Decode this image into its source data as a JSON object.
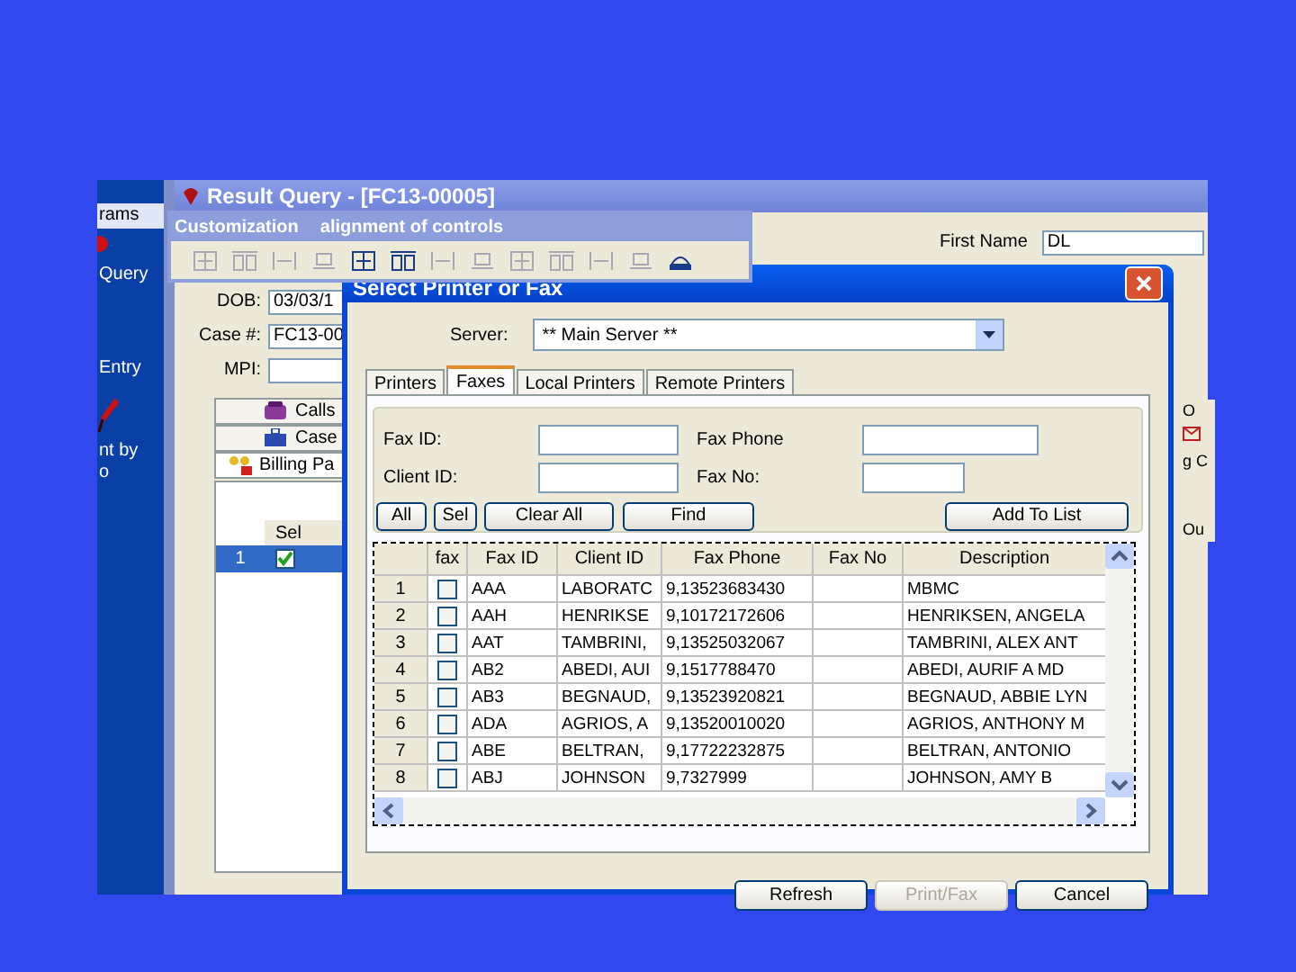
{
  "sidebar": {
    "items": [
      {
        "label": "rams",
        "selected": true
      },
      {
        "label": "Query",
        "selected": false
      },
      {
        "label": "Entry",
        "selected": false
      },
      {
        "label": "nt by",
        "selected": false
      },
      {
        "label": "o",
        "selected": false
      }
    ]
  },
  "main_window": {
    "title": "Result Query - [FC13-00005]",
    "fields": [
      {
        "label": "DOB:",
        "value": "03/03/1"
      },
      {
        "label": "Case #:",
        "value": "FC13-00"
      },
      {
        "label": "MPI:"
      }
    ],
    "first_name": {
      "label": "First Name",
      "value": "DL"
    },
    "tabs": [
      {
        "label": "Calls",
        "selected": false
      },
      {
        "label": "Case",
        "selected": false
      },
      {
        "label": "Billing Pa",
        "selected": true
      }
    ],
    "grid": {
      "columns": [
        "Sel"
      ],
      "rows": [
        {
          "number": "1",
          "checked": true,
          "selected": true
        }
      ]
    },
    "edge_texts": [
      "O",
      "g C",
      "Ou"
    ]
  },
  "toolbar": {
    "title": [
      "Customization",
      "alignment of controls"
    ]
  },
  "dialog": {
    "title": "Select Printer or Fax",
    "server": {
      "label": "Server:",
      "value": "** Main Server **"
    },
    "tabs": [
      {
        "label": "Printers",
        "selected": false
      },
      {
        "label": "Faxes",
        "selected": true
      },
      {
        "label": "Local Printers",
        "selected": false
      },
      {
        "label": "Remote Printers",
        "selected": false
      }
    ],
    "fields": [
      {
        "label": "Fax ID:"
      },
      {
        "label": "Fax Phone"
      },
      {
        "label": "Client ID:"
      },
      {
        "label": "Fax No:"
      }
    ],
    "buttons": [
      "All",
      "Sel",
      "Clear All",
      "Find",
      "Add To List"
    ],
    "table": {
      "columns": [
        "fax",
        "Fax ID",
        "Client ID",
        "Fax Phone",
        "Fax No",
        "Description"
      ],
      "rows": [
        {
          "number": "1",
          "checked": false,
          "fax_id": "AAA",
          "client_id": "LABORATC",
          "fax_phone": "9,13523683430",
          "description": "MBMC"
        },
        {
          "number": "2",
          "checked": false,
          "fax_id": "AAH",
          "client_id": "HENRIKSE",
          "fax_phone": "9,10172172606",
          "description": "HENRIKSEN, ANGELA"
        },
        {
          "number": "3",
          "checked": false,
          "fax_id": "AAT",
          "client_id": "TAMBRINI,",
          "fax_phone": "9,13525032067",
          "description": "TAMBRINI, ALEX ANT"
        },
        {
          "number": "4",
          "checked": false,
          "fax_id": "AB2",
          "client_id": "ABEDI, AUI",
          "fax_phone": "9,1517788470",
          "description": "ABEDI, AURIF A MD"
        },
        {
          "number": "5",
          "checked": false,
          "fax_id": "AB3",
          "client_id": "BEGNAUD,",
          "fax_phone": "9,13523920821",
          "description": "BEGNAUD, ABBIE LYN"
        },
        {
          "number": "6",
          "checked": false,
          "fax_id": "ADA",
          "client_id": "AGRIOS, A",
          "fax_phone": "9,13520010020",
          "description": "AGRIOS, ANTHONY M"
        },
        {
          "number": "7",
          "checked": false,
          "fax_id": "ABE",
          "client_id": "BELTRAN,",
          "fax_phone": "9,17722232875",
          "description": "BELTRAN, ANTONIO"
        },
        {
          "number": "8",
          "checked": false,
          "fax_id": "ABJ",
          "client_id": "JOHNSON",
          "fax_phone": "9,7327999",
          "description": "JOHNSON, AMY B"
        }
      ]
    },
    "footer_buttons": [
      {
        "label": "Refresh",
        "disabled": false
      },
      {
        "label": "Print/Fax",
        "disabled": true
      },
      {
        "label": "Cancel",
        "disabled": false
      }
    ]
  }
}
